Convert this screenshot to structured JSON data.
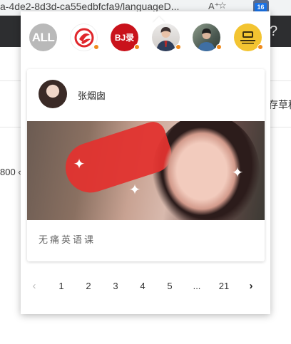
{
  "browser": {
    "url_fragment": "a-4de2-8d3d-ca55edbfcfa9/languageD...",
    "reader_icon": "A⁺",
    "star_icon": "☆",
    "extension_badge": "16",
    "help_glyph": "?",
    "bg_right_text": "存草稿",
    "bg_left_text": "800 ‹"
  },
  "popup": {
    "accounts": [
      {
        "name": "ALL",
        "icon": "all-icon"
      },
      {
        "name": "fenghuang",
        "icon": "fenghuang-logo-icon"
      },
      {
        "name": "bjl",
        "label": "BJ录",
        "icon": "bjl-logo-icon"
      },
      {
        "name": "person-1",
        "icon": "person-avatar-icon"
      },
      {
        "name": "person-2",
        "icon": "person-avatar-icon"
      },
      {
        "name": "yellow-logo",
        "icon": "yellow-logo-icon"
      }
    ],
    "card": {
      "author_name": "张烟囱",
      "description": "无痛英语课"
    },
    "pagination": {
      "prev": "‹",
      "pages": [
        "1",
        "2",
        "3",
        "4",
        "5",
        "...",
        "21"
      ],
      "next": "›"
    },
    "colors": {
      "dot": "#f08a1c",
      "all_bg": "#b9b9b9",
      "bjl_bg": "#c9121b",
      "yellow_bg": "#f3c431"
    }
  }
}
